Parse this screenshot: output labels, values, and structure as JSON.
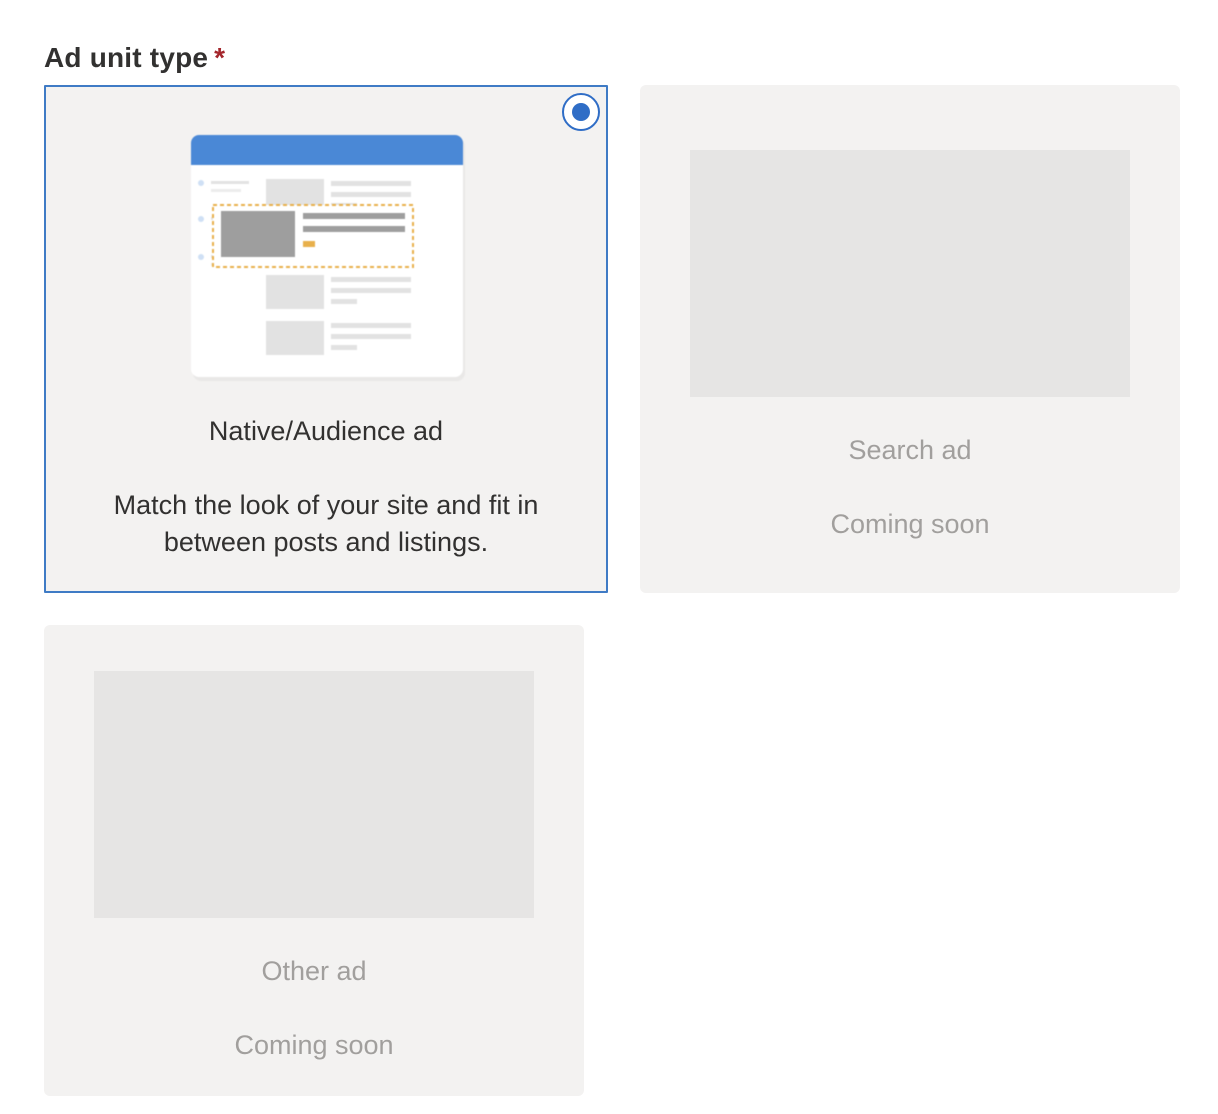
{
  "field": {
    "label": "Ad unit type",
    "required_marker": "*"
  },
  "options": [
    {
      "title": "Native/Audience ad",
      "description": "Match the look of your site and fit in between posts and listings.",
      "selected": true,
      "illustration_icon": "native-ad-illustration"
    },
    {
      "title": "Search ad",
      "status": "Coming soon",
      "selected": false
    },
    {
      "title": "Other ad",
      "status": "Coming soon",
      "selected": false
    }
  ],
  "colors": {
    "accent": "#2f6dc6",
    "card_background": "#f3f2f1",
    "placeholder": "#e6e5e4",
    "muted_text": "#a19f9d",
    "required": "#a4262c",
    "highlight": "#e8b04b"
  }
}
